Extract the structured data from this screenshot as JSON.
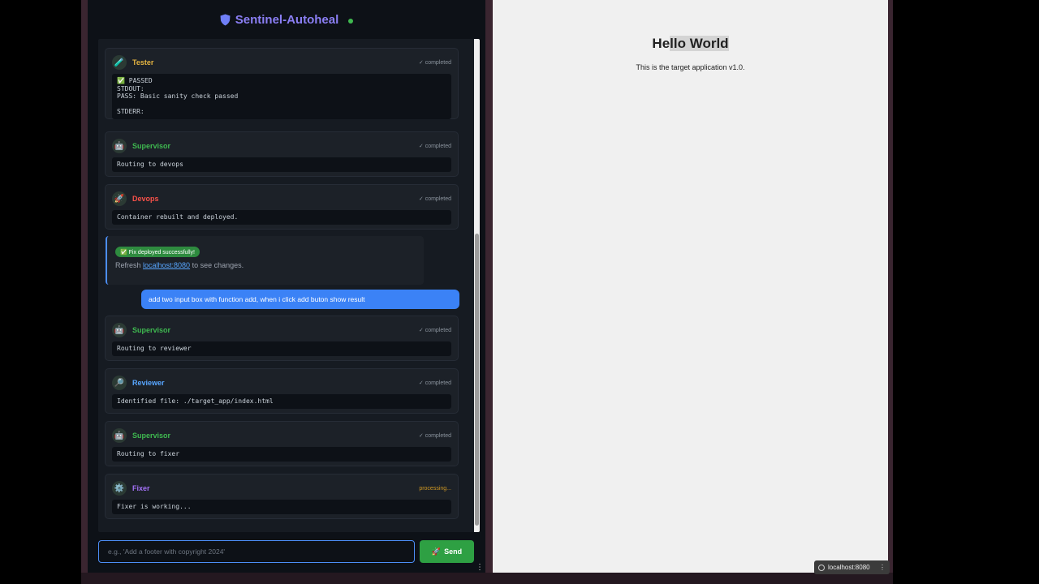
{
  "app": {
    "title": "Sentinel-Autoheal",
    "shield_icon": "shield-icon",
    "status_color": "#3fb950"
  },
  "messages": [
    {
      "agent": "Tester",
      "icon": "🧪",
      "color": "#e3b341",
      "status": "✓ completed",
      "body": "✅ PASSED\nSTDOUT:\nPASS: Basic sanity check passed\n\nSTDERR:"
    },
    {
      "agent": "Supervisor",
      "icon": "🤖",
      "color": "#3fb950",
      "status": "✓ completed",
      "body": "Routing to devops"
    },
    {
      "agent": "Devops",
      "icon": "🚀",
      "color": "#f85149",
      "status": "✓ completed",
      "body": "Container rebuilt and deployed."
    },
    {
      "agent": "Supervisor",
      "icon": "🤖",
      "color": "#3fb950",
      "status": "✓ completed",
      "body": "Routing to reviewer"
    },
    {
      "agent": "Reviewer",
      "icon": "🔎",
      "color": "#58a6ff",
      "status": "✓ completed",
      "body": "Identified file: ./target_app/index.html"
    },
    {
      "agent": "Supervisor",
      "icon": "🤖",
      "color": "#3fb950",
      "status": "✓ completed",
      "body": "Routing to fixer"
    },
    {
      "agent": "Fixer",
      "icon": "⚙️",
      "color": "#a371f7",
      "status": "processing...",
      "body": "Fixer is working..."
    }
  ],
  "deploy": {
    "badge": "✅ Fix deployed successfully!",
    "text_before": "Refresh ",
    "link": "localhost:8080",
    "text_after": " to see changes."
  },
  "user_message": "add two input box with function add, when i click add buton show result",
  "input": {
    "placeholder": "e.g., 'Add a footer with copyright 2024'",
    "value": ""
  },
  "send": {
    "icon": "🚀",
    "label": "Send"
  },
  "target_app": {
    "heading_pre": "He",
    "heading_hl": "llo World",
    "description": "This is the target application v1.0."
  },
  "browser": {
    "url": "localhost:8080",
    "menu": "⋮"
  }
}
